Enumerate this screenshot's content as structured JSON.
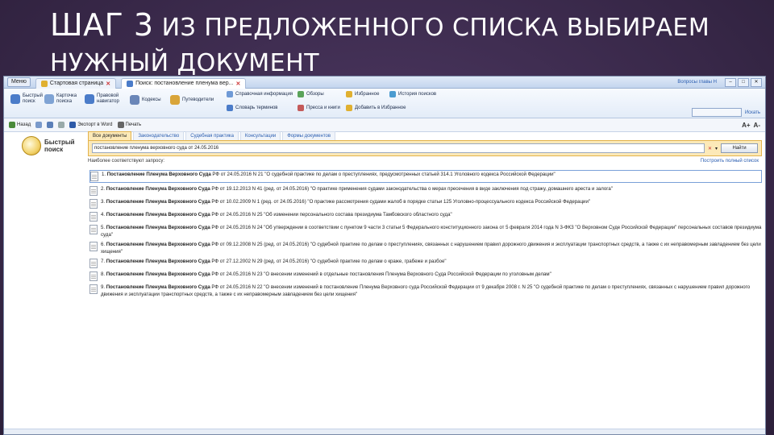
{
  "slide": {
    "title_line1_big": "ШАГ 3",
    "title_line1_rest": "ИЗ ПРЕДЛОЖЕННОГО СПИСКА ВЫБИРАЕМ",
    "title_line2": "НУЖНЫЙ ДОКУМЕНТ"
  },
  "window": {
    "menu_label": "Меню",
    "tabs": [
      {
        "label": "Стартовая страница"
      },
      {
        "label": "Поиск: постановление пленума вер..."
      }
    ],
    "link_right": "Вопросы главы Н"
  },
  "ribbon": {
    "left_items": [
      {
        "label": "Быстрый поиск",
        "color": "#4b7cc9"
      },
      {
        "label": "Карточка поиска",
        "color": "#7fa3d4"
      },
      {
        "label": "Правовой навигатор",
        "color": "#4b7cc9"
      },
      {
        "label": "Кодексы",
        "color": "#6a86b8"
      },
      {
        "label": "Путеводители",
        "color": "#d9a53a"
      }
    ],
    "mid_items": [
      {
        "label": "Справочная информация",
        "color": "#6f9ad6"
      },
      {
        "label": "Обзоры",
        "color": "#5aa35a"
      },
      {
        "label": "Словарь терминов",
        "color": "#4b7cc9"
      },
      {
        "label": "Пресса и книги",
        "color": "#c45a5a"
      }
    ],
    "right_items": [
      {
        "label": "Избранное",
        "color": "#e0b030"
      },
      {
        "label": "История поисков",
        "color": "#4b9bd0"
      },
      {
        "label": "Добавить в Избранное",
        "color": "#e0b030"
      }
    ],
    "search_link": "Искать"
  },
  "toolbar": {
    "back": "Назад",
    "word": "Экспорт в Word",
    "print": "Печать",
    "font_up": "A+",
    "font_down": "A-"
  },
  "quick_search": {
    "logo_line1": "Быстрый",
    "logo_line2": "поиск",
    "tabs": [
      {
        "label": "Все документы",
        "active": true
      },
      {
        "label": "Законодательство",
        "active": false
      },
      {
        "label": "Судебная практика",
        "active": false
      },
      {
        "label": "Консультации",
        "active": false
      },
      {
        "label": "Формы документов",
        "active": false
      }
    ],
    "query": "постановление пленума верховного суда от 24.05.2016",
    "button": "Найти",
    "hint": "Наиболее соответствуют запросу:",
    "extended_link": "Построить полный список"
  },
  "results": [
    {
      "num": "1.",
      "bold": "Постановление Пленума Верховного Суда",
      "text": " РФ от 24.05.2016 N 21 \"О судебной практике по делам о преступлениях, предусмотренных статьей 314.1 Уголовного кодекса Российской Федерации\"",
      "selected": true
    },
    {
      "num": "2.",
      "bold": "Постановление Пленума Верховного Суда",
      "text": " РФ от 19.12.2013 N 41 (ред. от 24.05.2016) \"О практике применения судами законодательства о мерах пресечения в виде заключения под стражу, домашнего ареста и залога\"",
      "selected": false
    },
    {
      "num": "3.",
      "bold": "Постановление Пленума Верховного Суда",
      "text": " РФ от 10.02.2009 N 1 (ред. от 24.05.2016) \"О практике рассмотрения судами жалоб в порядке статьи 125 Уголовно-процессуального кодекса Российской Федерации\"",
      "selected": false
    },
    {
      "num": "4.",
      "bold": "Постановление Пленума Верховного Суда",
      "text": " РФ от 24.05.2016 N 25 \"Об изменении персонального состава президиума Тамбовского областного суда\"",
      "selected": false
    },
    {
      "num": "5.",
      "bold": "Постановление Пленума Верховного Суда",
      "text": " РФ от 24.05.2016 N 24 \"Об утверждении в соответствии с пунктом 9 части 3 статьи 5 Федерального конституционного закона от 5 февраля 2014 года N 3-ФКЗ \"О Верховном Суде Российской Федерации\" персональных составов президиума суда\"",
      "selected": false
    },
    {
      "num": "6.",
      "bold": "Постановление Пленума Верховного Суда",
      "text": " РФ от 09.12.2008 N 25 (ред. от 24.05.2016) \"О судебной практике по делам о преступлениях, связанных с нарушением правил дорожного движения и эксплуатации транспортных средств, а также с их неправомерным завладением без цели хищения\"",
      "selected": false
    },
    {
      "num": "7.",
      "bold": "Постановление Пленума Верховного Суда",
      "text": " РФ от 27.12.2002 N 29 (ред. от 24.05.2016) \"О судебной практике по делам о краже, грабеже и разбое\"",
      "selected": false
    },
    {
      "num": "8.",
      "bold": "Постановление Пленума Верховного Суда",
      "text": " РФ от 24.05.2016 N 23 \"О внесении изменений в отдельные постановления Пленума Верховного Суда Российской Федерации по уголовным делам\"",
      "selected": false
    },
    {
      "num": "9.",
      "bold": "Постановление Пленума Верховного Суда",
      "text": " РФ от 24.05.2016 N 22 \"О внесении изменений в постановление Пленума Верховного суда Российской Федерации от 9 декабря 2008 г. N 25 \"О судебной практике по делам о преступлениях, связанных с нарушением правил дорожного движения и эксплуатации транспортных средств, а также с их неправомерным завладением без цели хищения\"",
      "selected": false
    }
  ]
}
